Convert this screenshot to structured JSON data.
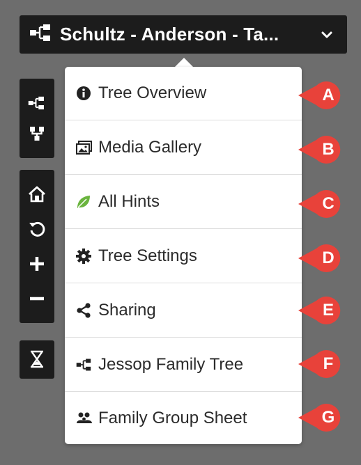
{
  "tree_selector": {
    "title": "Schultz - Anderson - Ta...",
    "icon": "family-tree-icon",
    "chevron": "chevron-down-icon"
  },
  "toolbar": {
    "groups": [
      [
        "family-tree-icon",
        "pedigree-icon"
      ],
      [
        "home-icon",
        "refresh-icon",
        "zoom-in-icon",
        "zoom-out-icon"
      ],
      [
        "hourglass-icon"
      ]
    ]
  },
  "menu": {
    "items": [
      {
        "label": "Tree Overview",
        "icon": "info-circle-icon",
        "marker": "A"
      },
      {
        "label": "Media Gallery",
        "icon": "image-gallery-icon",
        "marker": "B"
      },
      {
        "label": "All Hints",
        "icon": "leaf-icon",
        "marker": "C"
      },
      {
        "label": "Tree Settings",
        "icon": "gear-icon",
        "marker": "D"
      },
      {
        "label": "Sharing",
        "icon": "share-icon",
        "marker": "E"
      },
      {
        "label": "Jessop Family Tree",
        "icon": "family-tree-icon",
        "marker": "F"
      },
      {
        "label": "Family Group Sheet",
        "icon": "family-group-icon",
        "marker": "G"
      }
    ]
  },
  "colors": {
    "background": "#6d6d6d",
    "toolbar": "#1c1c1c",
    "marker": "#e8423a",
    "leaf": "#6ab43e"
  }
}
